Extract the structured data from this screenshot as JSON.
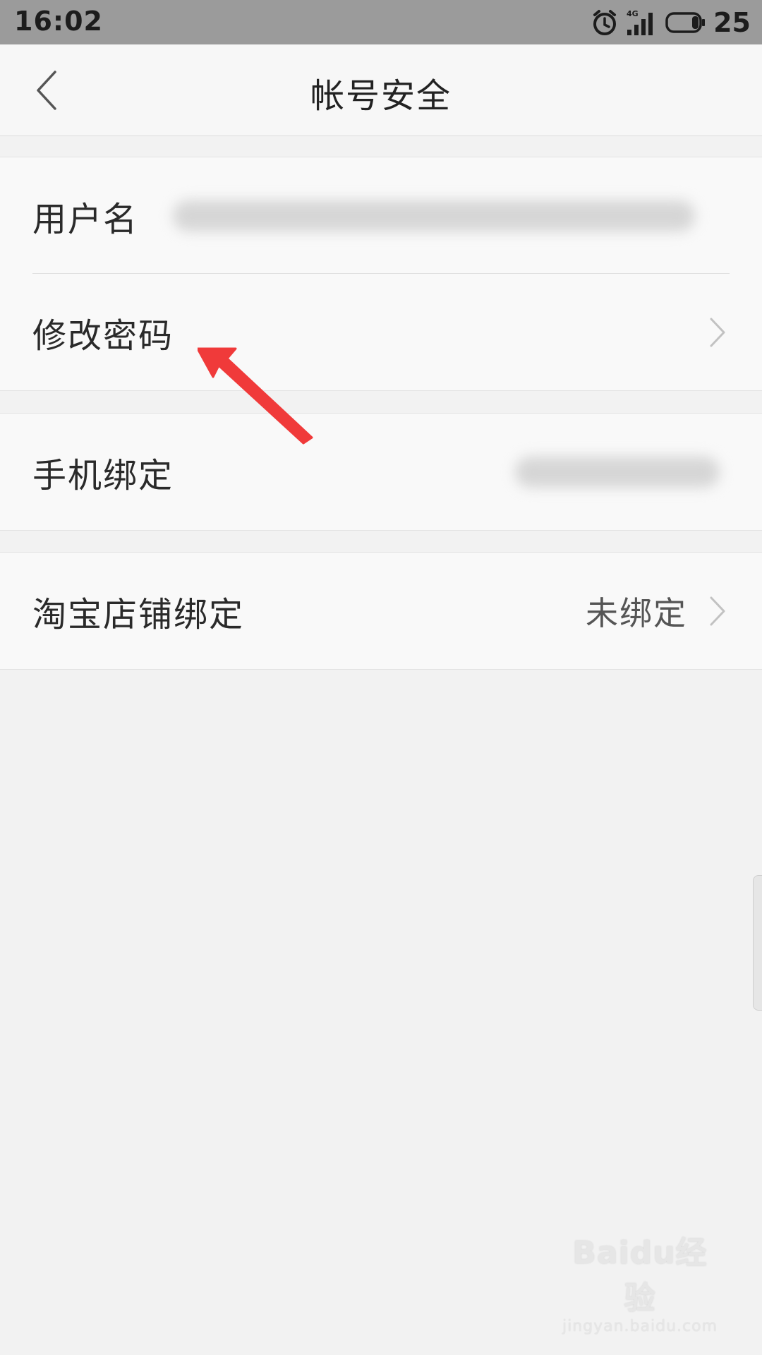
{
  "status_bar": {
    "time": "16:02",
    "network": "4G",
    "battery_level": "25",
    "icons": [
      "alarm-icon",
      "signal-icon",
      "battery-icon"
    ]
  },
  "header": {
    "title": "帐号安全",
    "back_icon": "chevron-left-icon"
  },
  "sections": {
    "account": {
      "username_label": "用户名",
      "change_password_label": "修改密码"
    },
    "phone": {
      "phone_binding_label": "手机绑定"
    },
    "taobao": {
      "taobao_binding_label": "淘宝店铺绑定",
      "taobao_binding_value": "未绑定"
    }
  },
  "annotation": {
    "arrow_color": "#f03a3a"
  },
  "watermark": {
    "logo": "Baidu经验",
    "url": "jingyan.baidu.com"
  },
  "colors": {
    "status_bar_bg": "#9b9b9b",
    "page_bg": "#f2f2f2",
    "row_bg": "#f9f9f9"
  }
}
